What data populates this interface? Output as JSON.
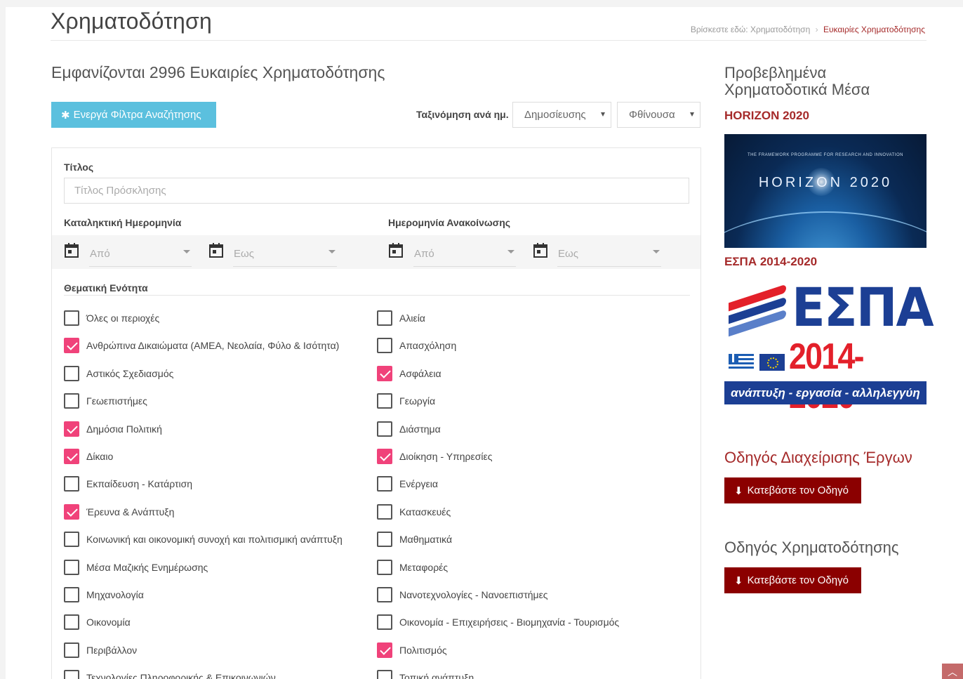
{
  "header": {
    "title": "Χρηματοδότηση",
    "breadcrumb_prefix": "Βρίσκεστε εδώ:",
    "breadcrumb_parent": "Χρηματοδότηση",
    "breadcrumb_current": "Ευκαιρίες Χρηματοδότησης"
  },
  "results": {
    "title": "Εμφανίζονται 2996 Ευκαιρίες Χρηματοδότησης"
  },
  "toolbar": {
    "filters_button": "Ενεργά Φίλτρα Αναζήτησης",
    "sort_label": "Ταξινόμηση ανά ημ.",
    "sort_field": "Δημοσίευσης",
    "sort_order": "Φθίνουσα"
  },
  "filters": {
    "title_label": "Τίτλος",
    "title_placeholder": "Τίτλος Πρόσκλησης",
    "deadline_label": "Καταληκτική Ημερομηνία",
    "announce_label": "Ημερομηνία Ανακοίνωσης",
    "from": "Από",
    "to": "Εως",
    "theme_label": "Θεματική Ενότητα",
    "left_items": [
      {
        "label": "Όλες οι περιοχές",
        "checked": false
      },
      {
        "label": "Ανθρώπινα Δικαιώματα (ΑΜΕΑ, Νεολαία, Φύλο & Ισότητα)",
        "checked": true
      },
      {
        "label": "Αστικός Σχεδιασμός",
        "checked": false
      },
      {
        "label": "Γεωεπιστήμες",
        "checked": false
      },
      {
        "label": "Δημόσια Πολιτική",
        "checked": true
      },
      {
        "label": "Δίκαιο",
        "checked": true
      },
      {
        "label": "Εκπαίδευση - Κατάρτιση",
        "checked": false
      },
      {
        "label": "Έρευνα & Ανάπτυξη",
        "checked": true
      },
      {
        "label": "Κοινωνική και οικονομική συνοχή και πολιτισμική ανάπτυξη",
        "checked": false
      },
      {
        "label": "Μέσα Μαζικής Ενημέρωσης",
        "checked": false
      },
      {
        "label": "Μηχανολογία",
        "checked": false
      },
      {
        "label": "Οικονομία",
        "checked": false
      },
      {
        "label": "Περιβάλλον",
        "checked": false
      },
      {
        "label": "Τεχνολογίες Πληροφορικής & Επικοινωνιών",
        "checked": false
      }
    ],
    "right_items": [
      {
        "label": "Αλιεία",
        "checked": false
      },
      {
        "label": "Απασχόληση",
        "checked": false
      },
      {
        "label": "Ασφάλεια",
        "checked": true
      },
      {
        "label": "Γεωργία",
        "checked": false
      },
      {
        "label": "Διάστημα",
        "checked": false
      },
      {
        "label": "Διοίκηση - Υπηρεσίες",
        "checked": true
      },
      {
        "label": "Ενέργεια",
        "checked": false
      },
      {
        "label": "Κατασκευές",
        "checked": false
      },
      {
        "label": "Μαθηματικά",
        "checked": false
      },
      {
        "label": "Μεταφορές",
        "checked": false
      },
      {
        "label": "Νανοτεχνολογίες - Νανοεπιστήμες",
        "checked": false
      },
      {
        "label": "Οικονομία - Επιχειρήσεις - Βιομηχανία - Τουρισμός",
        "checked": false
      },
      {
        "label": "Πολιτισμός",
        "checked": true
      },
      {
        "label": "Τοπική ανάπτυξη",
        "checked": false
      }
    ]
  },
  "sidebar": {
    "featured_line1": "Προβεβλημένα",
    "featured_line2": "Χρηματοδοτικά Μέσα",
    "program1": "HORIZON 2020",
    "horizon_tagline": "THE FRAMEWORK PROGRAMME FOR RESEARCH AND INNOVATION",
    "horizon_word": "HORIZON 2020",
    "program2": "ΕΣΠΑ 2014-2020",
    "espa_word": "ΕΣΠΑ",
    "espa_years": "2014-2020",
    "espa_slogan": "ανάπτυξη - εργασία - αλληλεγγύη",
    "guide1_title": "Οδηγός Διαχείρισης Έργων",
    "guide1_button": "Κατεβάστε τον Οδηγό",
    "guide2_title": "Οδηγός Χρηματοδότησης",
    "guide2_button": "Κατεβάστε τον Οδηγό"
  },
  "colors": {
    "accent_red": "#a52a2a",
    "button_blue": "#5bc0de",
    "checkbox_pink": "#f0427a",
    "download_red": "#8b0000"
  }
}
